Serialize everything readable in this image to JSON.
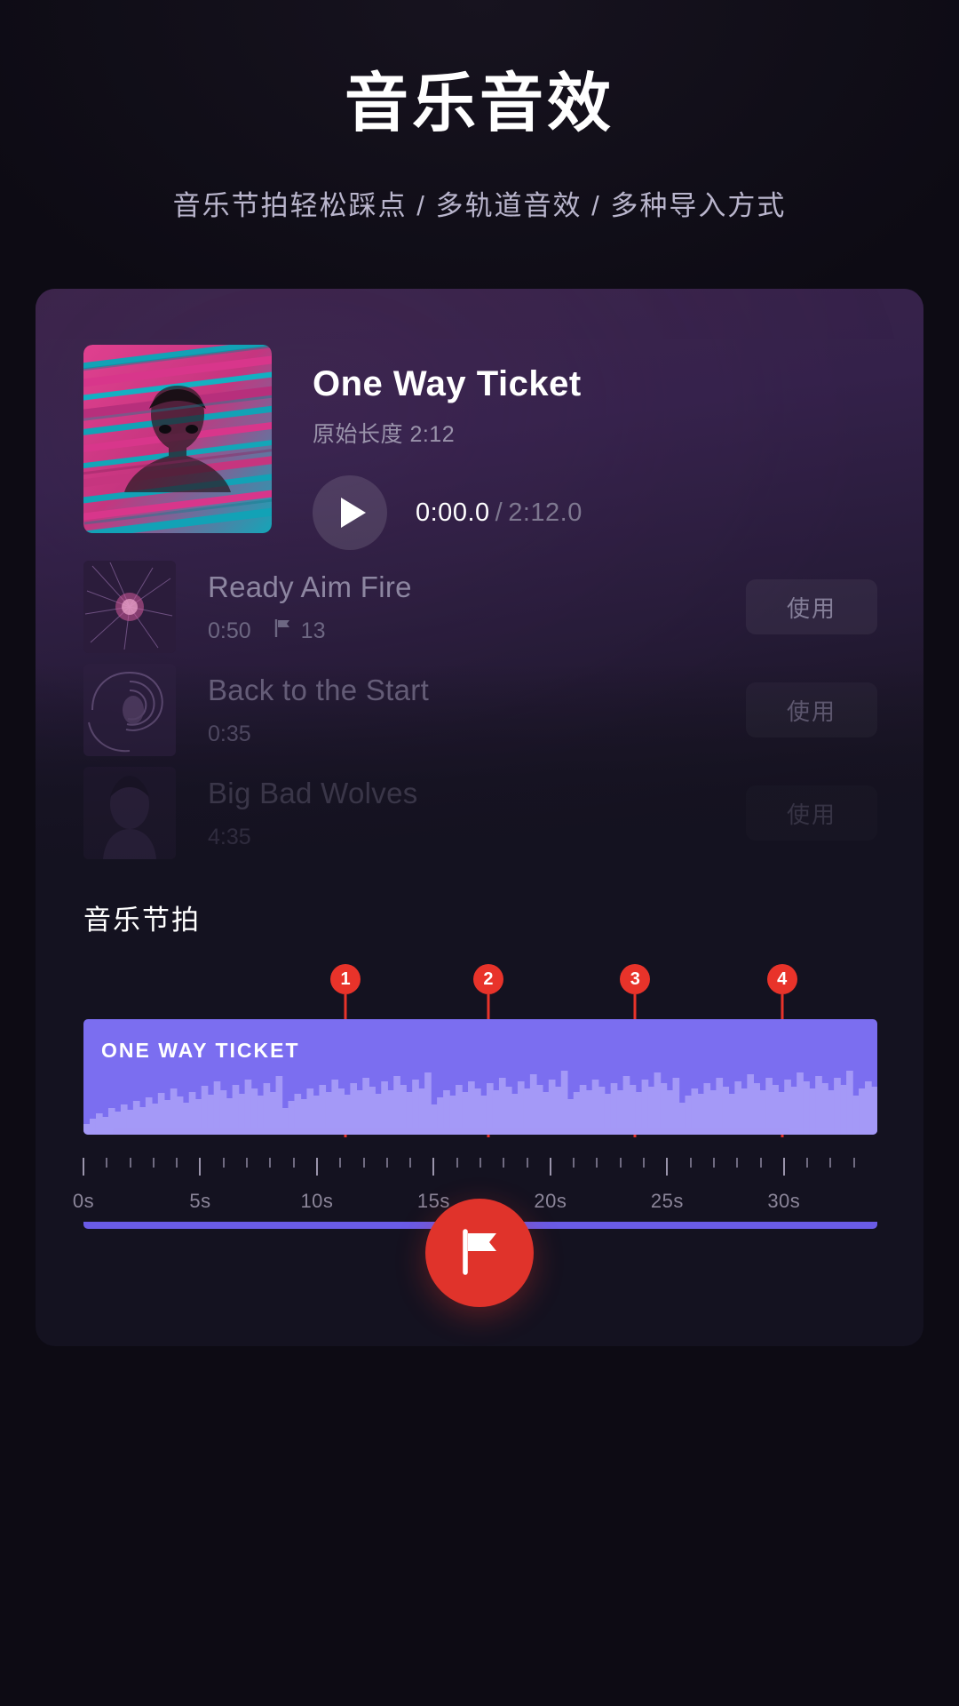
{
  "header": {
    "title": "音乐音效",
    "subtitle": "音乐节拍轻松踩点 / 多轨道音效 / 多种导入方式"
  },
  "now_playing": {
    "title": "One Way Ticket",
    "original_length_label": "原始长度 2:12",
    "current_time": "0:00.0",
    "separator": "/",
    "total_time": "2:12.0",
    "play_icon": "play-icon"
  },
  "tracks": [
    {
      "name": "Ready Aim Fire",
      "duration": "0:50",
      "beat_count": "13",
      "flag_icon": "flag-icon",
      "use_label": "使用"
    },
    {
      "name": "Back to the Start",
      "duration": "0:35",
      "beat_count": "",
      "flag_icon": "flag-icon",
      "use_label": "使用"
    },
    {
      "name": "Big Bad Wolves",
      "duration": "4:35",
      "beat_count": "",
      "flag_icon": "flag-icon",
      "use_label": "使用"
    }
  ],
  "beat_section": {
    "title": "音乐节拍",
    "waveform_label": "ONE WAY TICKET",
    "markers": [
      {
        "number": "1",
        "pos_pct": 33.0
      },
      {
        "number": "2",
        "pos_pct": 51.0
      },
      {
        "number": "3",
        "pos_pct": 69.5
      },
      {
        "number": "4",
        "pos_pct": 88.0
      }
    ],
    "ruler_labels": [
      "0s",
      "5s",
      "10s",
      "15s",
      "20s",
      "25s",
      "30s"
    ]
  },
  "fab": {
    "icon": "flag-icon",
    "label": ""
  },
  "colors": {
    "accent_red": "#e0332b",
    "wave_purple": "#7b6ef0",
    "page_bg": "#0d0b14",
    "card_bg": "#141220"
  },
  "chart_data": {
    "type": "area",
    "title": "ONE WAY TICKET",
    "xlabel": "",
    "ylabel": "",
    "xlim": [
      0,
      34
    ],
    "ylim": [
      0,
      1
    ],
    "grid": false,
    "legend": "none",
    "x_tick_labels": [
      "0s",
      "5s",
      "10s",
      "15s",
      "20s",
      "25s",
      "30s"
    ],
    "x_tick_values": [
      0,
      5,
      10,
      15,
      20,
      25,
      30
    ],
    "annotations": [
      {
        "label": "1",
        "x": 11.4
      },
      {
        "label": "2",
        "x": 17.6
      },
      {
        "label": "3",
        "x": 24.0
      },
      {
        "label": "4",
        "x": 30.4
      }
    ],
    "series": [
      {
        "name": "amplitude",
        "values": [
          0.12,
          0.18,
          0.24,
          0.2,
          0.3,
          0.26,
          0.34,
          0.28,
          0.38,
          0.31,
          0.42,
          0.35,
          0.47,
          0.39,
          0.52,
          0.43,
          0.36,
          0.48,
          0.4,
          0.55,
          0.45,
          0.6,
          0.5,
          0.41,
          0.56,
          0.46,
          0.62,
          0.52,
          0.44,
          0.58,
          0.48,
          0.66,
          0.3,
          0.38,
          0.46,
          0.4,
          0.52,
          0.44,
          0.56,
          0.48,
          0.62,
          0.52,
          0.45,
          0.58,
          0.5,
          0.64,
          0.54,
          0.46,
          0.6,
          0.5,
          0.66,
          0.56,
          0.48,
          0.62,
          0.52,
          0.7,
          0.34,
          0.42,
          0.5,
          0.44,
          0.56,
          0.48,
          0.6,
          0.52,
          0.44,
          0.58,
          0.5,
          0.64,
          0.54,
          0.46,
          0.6,
          0.52,
          0.68,
          0.56,
          0.48,
          0.62,
          0.54,
          0.72,
          0.4,
          0.48,
          0.56,
          0.5,
          0.62,
          0.54,
          0.46,
          0.58,
          0.5,
          0.66,
          0.56,
          0.48,
          0.62,
          0.54,
          0.7,
          0.58,
          0.5,
          0.64,
          0.36,
          0.44,
          0.52,
          0.46,
          0.58,
          0.5,
          0.64,
          0.54,
          0.46,
          0.6,
          0.52,
          0.68,
          0.58,
          0.5,
          0.64,
          0.56,
          0.48,
          0.62,
          0.54,
          0.7,
          0.6,
          0.52,
          0.66,
          0.58,
          0.5,
          0.64,
          0.56,
          0.72,
          0.44,
          0.52,
          0.6,
          0.54
        ]
      }
    ]
  }
}
